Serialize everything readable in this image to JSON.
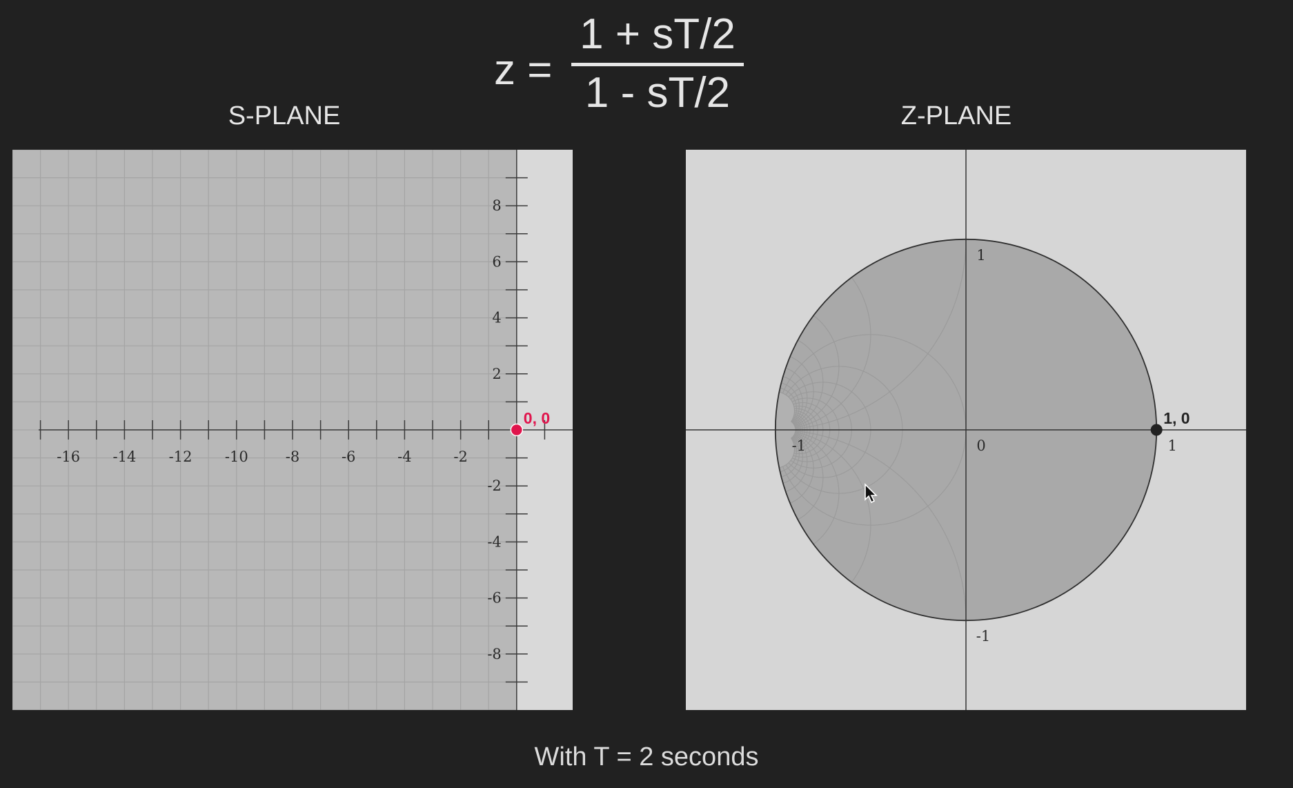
{
  "formula": {
    "lhs": "z =",
    "numerator": "1 + sT/2",
    "denominator": "1 - sT/2"
  },
  "s_plane": {
    "title": "S-PLANE",
    "real_range": [
      -18,
      2
    ],
    "imag_range": [
      -10,
      10
    ],
    "x_tick_labels": [
      "-16",
      "-14",
      "-12",
      "-10",
      "-8",
      "-6",
      "-4",
      "-2"
    ],
    "y_tick_labels": [
      "8",
      "6",
      "4",
      "2",
      "-2",
      "-4",
      "-6",
      "-8"
    ],
    "point": {
      "label": "0, 0",
      "re": 0,
      "im": 0,
      "color": "#e0144c"
    },
    "colors": {
      "left_half": "#b8b8b8",
      "right_half": "#d9d9d9",
      "grid": "#a4a4a4"
    }
  },
  "z_plane": {
    "title": "Z-PLANE",
    "real_range": [
      -1.47,
      1.47
    ],
    "imag_range": [
      -1.47,
      1.47
    ],
    "labels": {
      "neg_one_re": "-1",
      "zero": "0",
      "one_re": "1",
      "one_im": "1",
      "neg_one_im": "-1"
    },
    "point": {
      "label": "1, 0",
      "re": 1,
      "im": 0,
      "color": "#222222"
    },
    "colors": {
      "background": "#d6d6d6",
      "disk": "#b1b1b1",
      "grid": "#9a9a9a"
    }
  },
  "caption": "With T = 2 seconds"
}
